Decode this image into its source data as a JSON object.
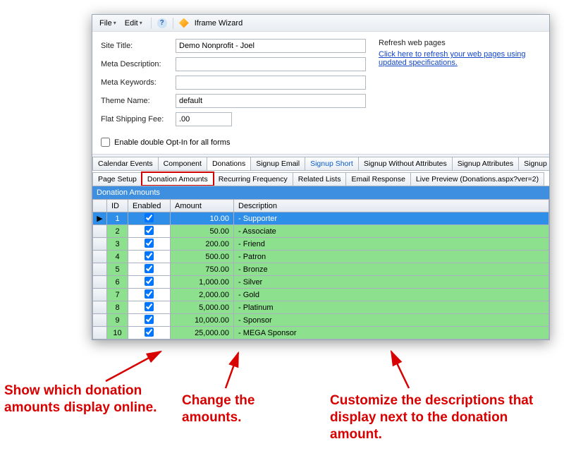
{
  "menubar": {
    "file": "File",
    "edit": "Edit",
    "wizard_title": "Iframe Wizard"
  },
  "form": {
    "site_title_label": "Site Title:",
    "site_title": "Demo Nonprofit - Joel",
    "meta_desc_label": "Meta Description:",
    "meta_desc": "",
    "meta_keywords_label": "Meta Keywords:",
    "meta_keywords": "",
    "theme_label": "Theme Name:",
    "theme": "default",
    "shipping_label": "Flat Shipping Fee:",
    "shipping": ".00",
    "optin_label": "Enable double Opt-In for all forms"
  },
  "refresh": {
    "title": "Refresh web pages",
    "link": "Click here to refresh your web pages using updated specifications."
  },
  "tabs_top": [
    {
      "label": "Calendar Events",
      "active": false
    },
    {
      "label": "Component",
      "active": false
    },
    {
      "label": "Donations",
      "active": true
    },
    {
      "label": "Signup Email",
      "active": false
    },
    {
      "label": "Signup Short",
      "active": false,
      "blue": true
    },
    {
      "label": "Signup Without Attributes",
      "active": false
    },
    {
      "label": "Signup Attributes",
      "active": false
    },
    {
      "label": "Signup Post",
      "active": false
    }
  ],
  "tabs_second": [
    {
      "label": "Page Setup",
      "active": false
    },
    {
      "label": "Donation Amounts",
      "active": true,
      "highlight": true
    },
    {
      "label": "Recurring Frequency",
      "active": false
    },
    {
      "label": "Related Lists",
      "active": false
    },
    {
      "label": "Email Response",
      "active": false
    },
    {
      "label": "Live Preview (Donations.aspx?ver=2)",
      "active": false
    }
  ],
  "grid": {
    "title": "Donation Amounts",
    "headers": {
      "id": "ID",
      "enabled": "Enabled",
      "amount": "Amount",
      "description": "Description"
    },
    "rows": [
      {
        "id": "1",
        "enabled": true,
        "amount": "10.00",
        "description": "- Supporter",
        "selected": true
      },
      {
        "id": "2",
        "enabled": true,
        "amount": "50.00",
        "description": "- Associate"
      },
      {
        "id": "3",
        "enabled": true,
        "amount": "200.00",
        "description": "- Friend"
      },
      {
        "id": "4",
        "enabled": true,
        "amount": "500.00",
        "description": "- Patron"
      },
      {
        "id": "5",
        "enabled": true,
        "amount": "750.00",
        "description": "- Bronze"
      },
      {
        "id": "6",
        "enabled": true,
        "amount": "1,000.00",
        "description": "- Silver"
      },
      {
        "id": "7",
        "enabled": true,
        "amount": "2,000.00",
        "description": "- Gold"
      },
      {
        "id": "8",
        "enabled": true,
        "amount": "5,000.00",
        "description": "- Platinum"
      },
      {
        "id": "9",
        "enabled": true,
        "amount": "10,000.00",
        "description": "- Sponsor"
      },
      {
        "id": "10",
        "enabled": true,
        "amount": "25,000.00",
        "description": "- MEGA Sponsor"
      }
    ]
  },
  "annotations": {
    "a1": "Show which donation amounts display online.",
    "a2": "Change the amounts.",
    "a3": "Customize the descriptions that display next to the donation amount."
  }
}
